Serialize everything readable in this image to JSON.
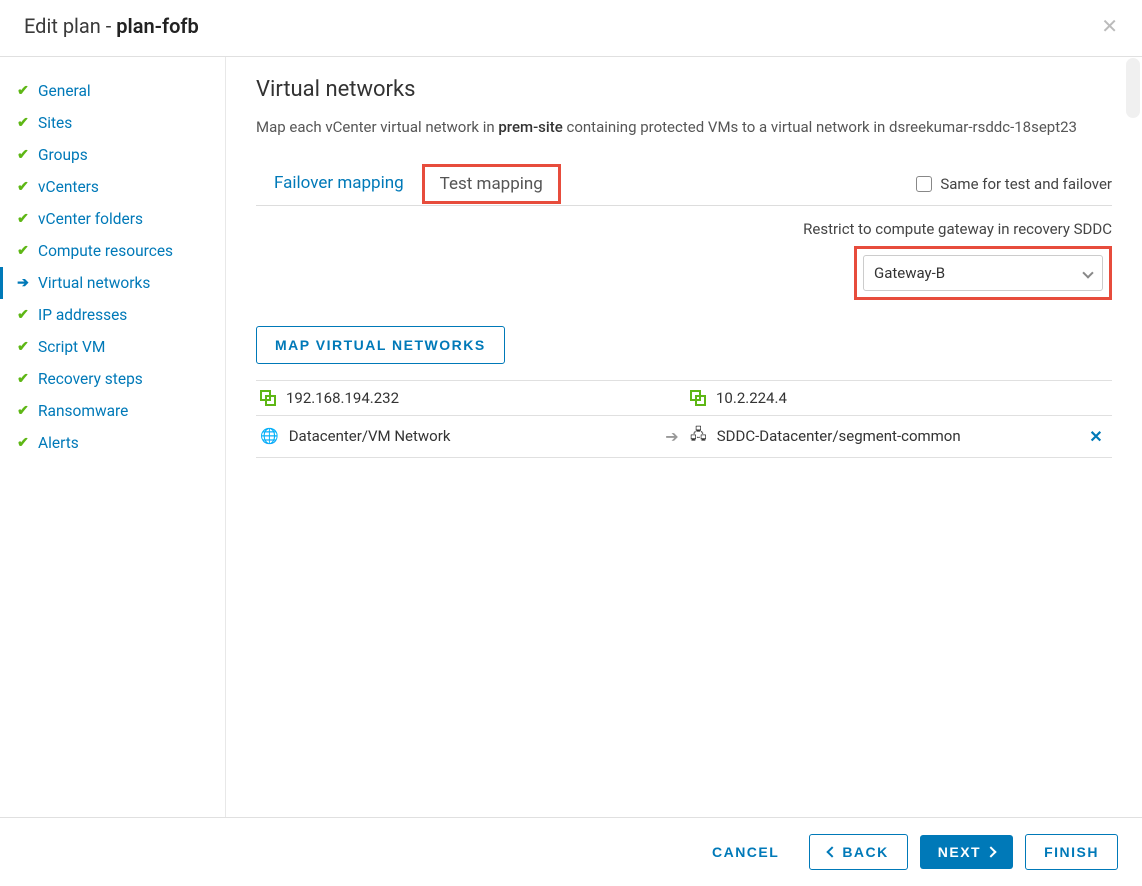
{
  "header": {
    "prefix": "Edit plan - ",
    "plan_name": "plan-fofb"
  },
  "sidebar": {
    "items": [
      {
        "label": "General",
        "status": "done"
      },
      {
        "label": "Sites",
        "status": "done"
      },
      {
        "label": "Groups",
        "status": "done"
      },
      {
        "label": "vCenters",
        "status": "done"
      },
      {
        "label": "vCenter folders",
        "status": "done"
      },
      {
        "label": "Compute resources",
        "status": "done"
      },
      {
        "label": "Virtual networks",
        "status": "active"
      },
      {
        "label": "IP addresses",
        "status": "done"
      },
      {
        "label": "Script VM",
        "status": "done"
      },
      {
        "label": "Recovery steps",
        "status": "done"
      },
      {
        "label": "Ransomware",
        "status": "done"
      },
      {
        "label": "Alerts",
        "status": "done"
      }
    ]
  },
  "main": {
    "title": "Virtual networks",
    "desc_pre": "Map each vCenter virtual network in ",
    "desc_bold1": "prem-site",
    "desc_mid": " containing protected VMs to a virtual network in ",
    "desc_bold2": "dsreekumar-rsddc-18sept23",
    "tabs": {
      "failover": "Failover mapping",
      "test": "Test mapping"
    },
    "same_label": "Same for test and failover",
    "restrict_label": "Restrict to compute gateway in recovery SDDC",
    "gateway_selected": "Gateway-B",
    "map_button": "MAP VIRTUAL NETWORKS",
    "table": {
      "header_left": "192.168.194.232",
      "header_right": "10.2.224.4",
      "rows": [
        {
          "left": "Datacenter/VM Network",
          "right": "SDDC-Datacenter/segment-common"
        }
      ]
    }
  },
  "footer": {
    "cancel": "CANCEL",
    "back": "BACK",
    "next": "NEXT",
    "finish": "FINISH"
  }
}
